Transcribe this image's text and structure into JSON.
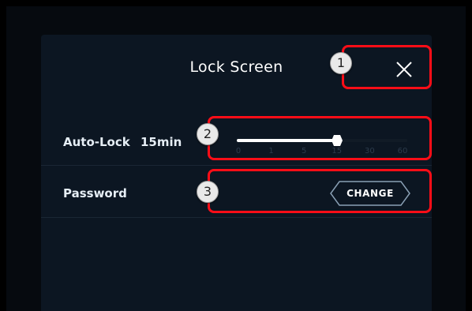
{
  "dialog": {
    "title": "Lock Screen",
    "close_icon": "close-icon"
  },
  "auto_lock": {
    "label": "Auto-Lock",
    "value_text": "15min",
    "slider": {
      "ticks": [
        "0",
        "1",
        "5",
        "15",
        "30",
        "60"
      ],
      "selected_index": 3,
      "fill_color": "#ffffff",
      "track_color": "#111b26"
    }
  },
  "password": {
    "label": "Password",
    "button_label": "CHANGE"
  },
  "annotations": [
    {
      "number": "1"
    },
    {
      "number": "2"
    },
    {
      "number": "3"
    }
  ],
  "colors": {
    "panel_bg": "#0c1622",
    "highlight": "#ff0d17",
    "button_border": "#8aa0b5"
  }
}
